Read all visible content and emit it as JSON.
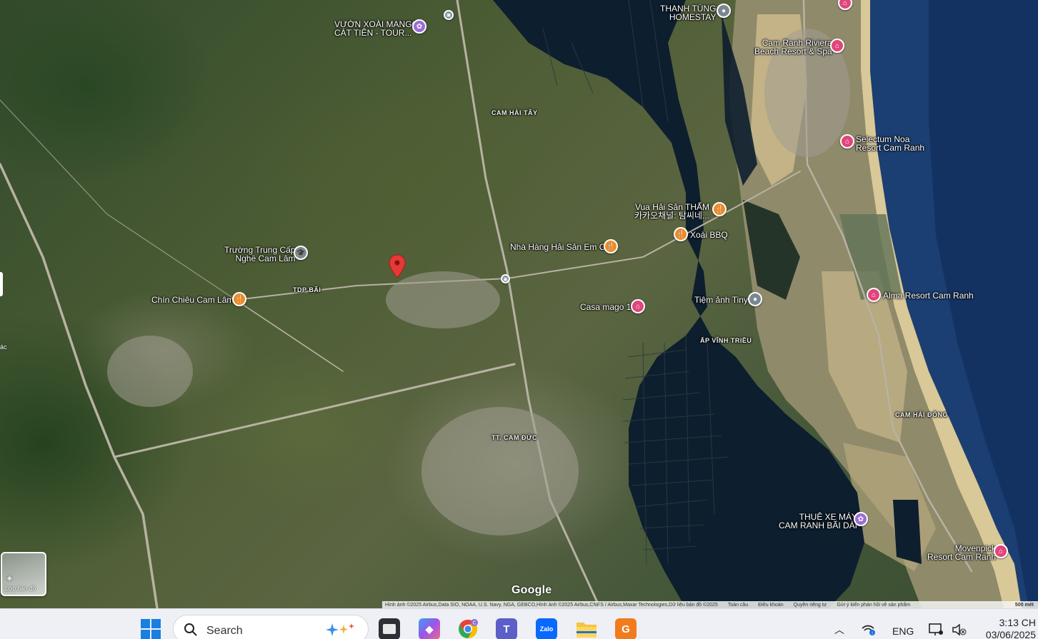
{
  "map": {
    "places": [
      {
        "id": "vuon-xoai",
        "lines": [
          "VƯỜN XOÀI MANGO",
          "CÁT TIÊN - TOUR..."
        ]
      },
      {
        "id": "thanh-tung",
        "lines": [
          "THANH TÙNG",
          "HOMESTAY"
        ]
      },
      {
        "id": "cam-ranh-riviera",
        "lines": [
          "Cam Ranh Riviera",
          "Beach Resort & Spa"
        ]
      },
      {
        "id": "selectum",
        "lines": [
          "Selectum Noa",
          "Resort Cam Ranh"
        ]
      },
      {
        "id": "vua-hai-san",
        "lines": [
          "Vua Hải Sản THẨM",
          "카카오채널: 탐씨네..."
        ]
      },
      {
        "id": "xoai-bbq",
        "lines": [
          "Xoài BBQ"
        ]
      },
      {
        "id": "nha-hang",
        "lines": [
          "Nhà Hàng Hải Sản Em Ơi"
        ]
      },
      {
        "id": "truong-trung-cap",
        "lines": [
          "Trường Trung Cấp",
          "Nghề Cam Lâm"
        ]
      },
      {
        "id": "chin-chieu",
        "lines": [
          "Chín Chiêu Cam Lâm"
        ]
      },
      {
        "id": "casa-mago",
        "lines": [
          "Casa mago 1"
        ]
      },
      {
        "id": "tiem-anh",
        "lines": [
          "Tiệm ảnh Tiny"
        ]
      },
      {
        "id": "alma",
        "lines": [
          "Alma Resort Cam Ranh"
        ]
      },
      {
        "id": "thue-xe",
        "lines": [
          "THUÊ XE MÁY",
          "CAM RANH BÃI DÀI"
        ]
      },
      {
        "id": "movenpick",
        "lines": [
          "Movenpick",
          "Resort Cam Ranh"
        ]
      }
    ],
    "areas": {
      "cam_hai_tay": "CAM HẢI TÂY",
      "tdp_bai": "TDP BÃI",
      "ap_vinh_trieu": "ẤP VĨNH TRIỀU",
      "cam_hai_dong": "CAM HẢI ĐÔNG",
      "tt_cam_duc": "TT. CAM ĐỨC"
    },
    "google_logo": "Google",
    "attribution": {
      "imagery": "Hình ảnh ©2025 Airbus,Data SIO, NOAA, U.S. Navy, NGA, GEBCO,Hình ảnh ©2025 Airbus,CNES / Airbus,Maxar Technologies,Dữ liệu bản đồ ©2025",
      "global": "Toàn cầu",
      "terms": "Điều khoản",
      "privacy": "Quyền riêng tư",
      "feedback": "Gửi ý kiến phản hồi về sản phẩm",
      "scale": "500 mét"
    },
    "layer_button": "Lớp bản đồ",
    "edge_text": "ác",
    "colors": {
      "water": "#0d1e2e",
      "sea": "#1b3f73",
      "beach": "#d6c69a",
      "red_pin": "#e53935"
    }
  },
  "taskbar": {
    "search_placeholder": "Search",
    "language": "ENG",
    "time": "3:13 CH",
    "date": "03/06/2025",
    "apps": [
      "windows-start",
      "file-explorer-dark",
      "copilot",
      "chrome",
      "teams",
      "zalo",
      "file-explorer",
      "foxit"
    ]
  }
}
